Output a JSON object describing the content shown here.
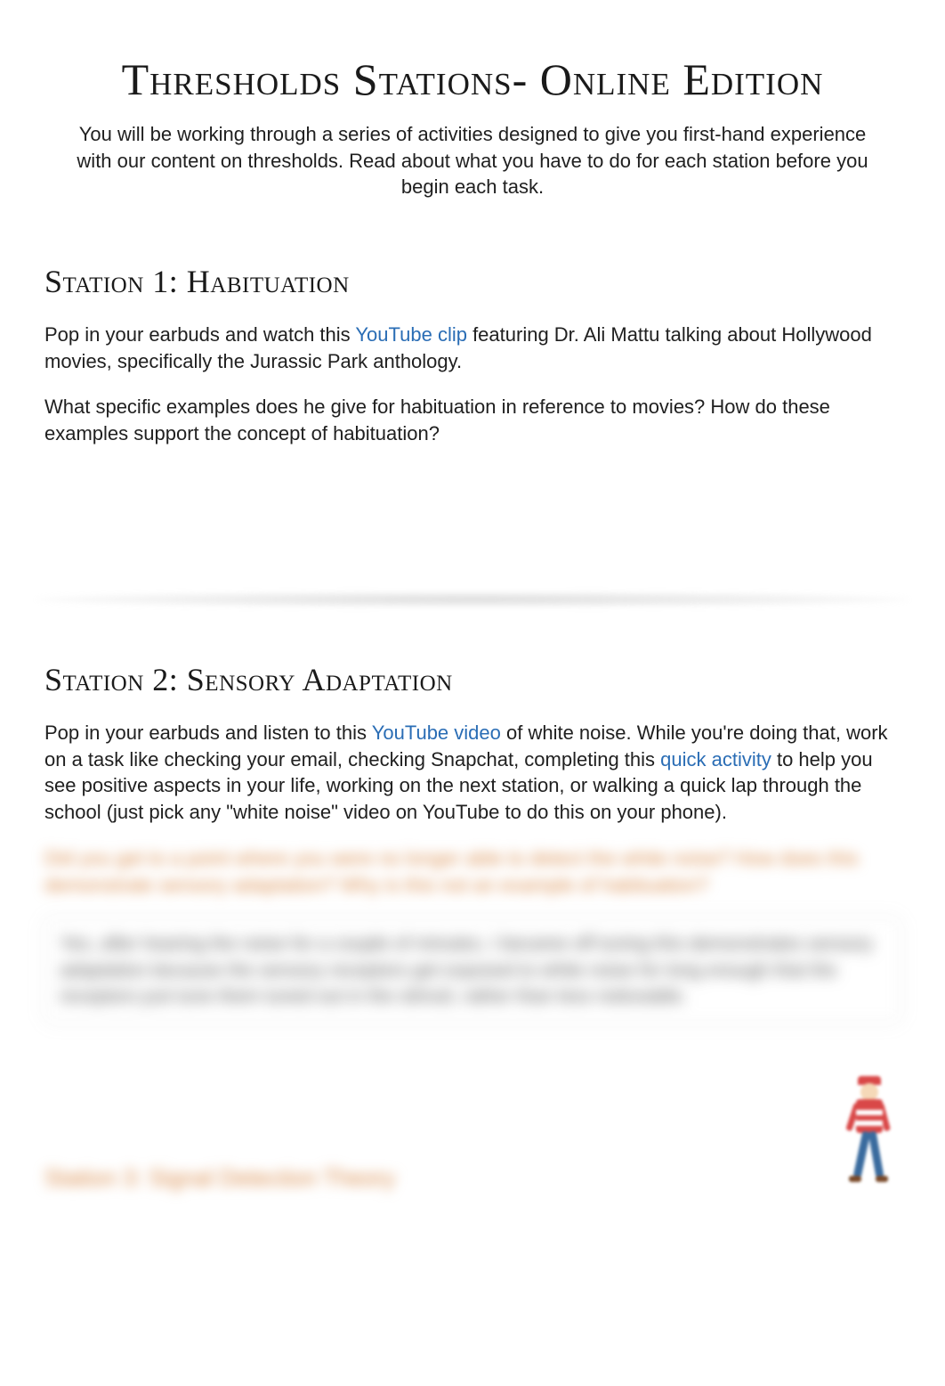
{
  "title": "Thresholds Stations- Online Edition",
  "intro": "You will be working through a series of activities designed to give you first-hand experience with our content on thresholds. Read about what you have to do for each station before you begin each task.",
  "station1": {
    "heading": "Station 1: Habituation",
    "p1_pre": "Pop in your earbuds and watch this ",
    "link1": "YouTube clip",
    "p1_post": " featuring Dr. Ali Mattu talking about Hollywood movies, specifically the Jurassic Park anthology.",
    "p2": "What specific examples does he give for habituation in reference to movies? How do these examples support the concept of habituation?"
  },
  "station2": {
    "heading": "Station 2: Sensory Adaptation",
    "p1_a": "Pop in your earbuds and listen to this ",
    "link1": "YouTube video",
    "p1_b": " of white noise. While you're doing that, work on a task like checking your email, checking Snapchat, completing this ",
    "link2": "quick activity",
    "p1_c": " to help you see positive aspects in your life, working on the next station, or walking a quick lap through the school (just pick any \"white noise\" video on YouTube to do this on your phone).",
    "blurred_q": "Did you get to a point where you were no longer able to detect the white noise? How does this demonstrate sensory adaptation? Why is this not an example of habituation?",
    "blurred_a": "Yes, after hearing the noise for a couple of minutes, I became off tuning           this demonstrates sensory adaptation because the sensory receptors get exposed to white noise for long enough that the receptors just tune them tuned out in the stimuli, rather than less noticeable."
  },
  "station3_blurred": "Station 3: Signal Detection Theory"
}
